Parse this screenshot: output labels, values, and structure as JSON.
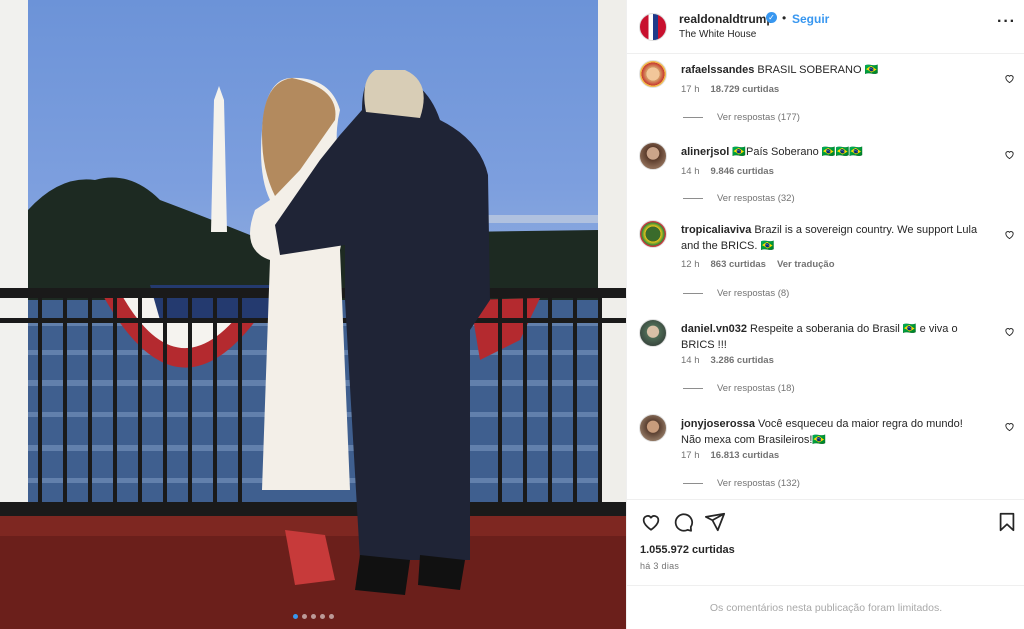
{
  "post": {
    "username": "realdonaldtrump",
    "separator": "•",
    "follow_label": "Seguir",
    "location": "The White House",
    "likes": "1.055.972 curtidas",
    "posted": "há 3 dias",
    "comments_limited": "Os comentários nesta publicação foram limitados.",
    "carousel": {
      "slides": 5,
      "active": 1
    }
  },
  "comments": [
    {
      "user": "rafaelssandes",
      "text": "BRASIL SOBERANO 🇧🇷",
      "time": "17 h",
      "likes": "18.729 curtidas",
      "translate": "",
      "replies": "Ver respostas (177)"
    },
    {
      "user": "alinerjsol",
      "text": "🇧🇷País Soberano 🇧🇷🇧🇷🇧🇷",
      "time": "14 h",
      "likes": "9.846 curtidas",
      "translate": "",
      "replies": "Ver respostas (32)"
    },
    {
      "user": "tropicaliaviva",
      "text": "Brazil is a sovereign country. We support Lula and the BRICS. 🇧🇷",
      "time": "12 h",
      "likes": "863 curtidas",
      "translate": "Ver tradução",
      "replies": "Ver respostas (8)"
    },
    {
      "user": "daniel.vn032",
      "text": "Respeite a soberania do Brasil 🇧🇷 e viva o BRICS !!!",
      "time": "14 h",
      "likes": "3.286 curtidas",
      "translate": "",
      "replies": "Ver respostas (18)"
    },
    {
      "user": "jonyjoserossa",
      "text": "Você esqueceu da maior regra do mundo! Não mexa com Brasileiros!🇧🇷",
      "time": "17 h",
      "likes": "16.813 curtidas",
      "translate": "",
      "replies": "Ver respostas (132)"
    }
  ],
  "icons": {
    "more": "more-options-icon",
    "like": "heart-icon",
    "comment": "comment-icon",
    "share": "share-icon",
    "save": "bookmark-icon"
  },
  "colors": {
    "accent": "#3897f0",
    "text": "#262626",
    "secondary": "#737373"
  }
}
